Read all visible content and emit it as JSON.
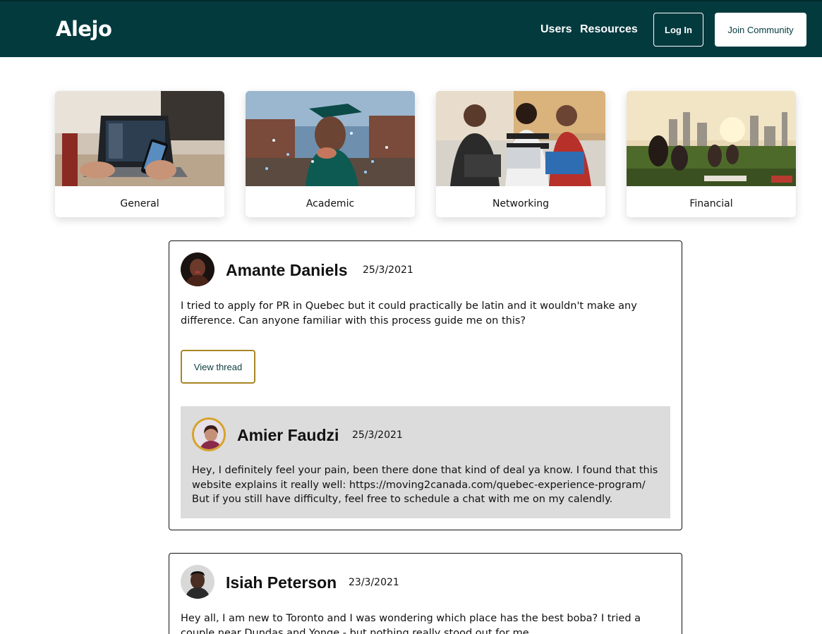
{
  "navbar": {
    "logo": "Alejo",
    "links": [
      "Users",
      "Resources"
    ],
    "login_label": "Log In",
    "join_label": "Join Community",
    "background": "#033a3e"
  },
  "categories": [
    {
      "label": "General",
      "image": "laptop-phone-photo"
    },
    {
      "label": "Academic",
      "image": "graduate-confetti-photo"
    },
    {
      "label": "Networking",
      "image": "friends-laptops-photo"
    },
    {
      "label": "Financial",
      "image": "city-park-sunset-photo"
    }
  ],
  "posts": [
    {
      "author": "Amante Daniels",
      "date": "25/3/2021",
      "body": "I tried to apply for PR in Quebec but it could practically be latin and it wouldn't make any difference. Can anyone familiar with this process guide me on this?",
      "view_label": "View thread",
      "reply": {
        "author": "Amier Faudzi",
        "date": "25/3/2021",
        "body": "Hey, I definitely feel your pain, been there done that kind of deal ya know. I found that this website explains it really well: https://moving2canada.com/quebec-experience-program/ But if you still have difficulty, feel free to schedule a chat with me on my calendly."
      }
    },
    {
      "author": "Isiah Peterson",
      "date": "23/3/2021",
      "body": "Hey all, I am new to Toronto and I was wondering which place has the best boba? I tried a couple near Dundas and Yonge - but nothing really stood out for me."
    }
  ],
  "colors": {
    "accent_border": "#a88624",
    "reply_background": "#dcdcdc",
    "avatar_ring": "#d8a32a"
  }
}
